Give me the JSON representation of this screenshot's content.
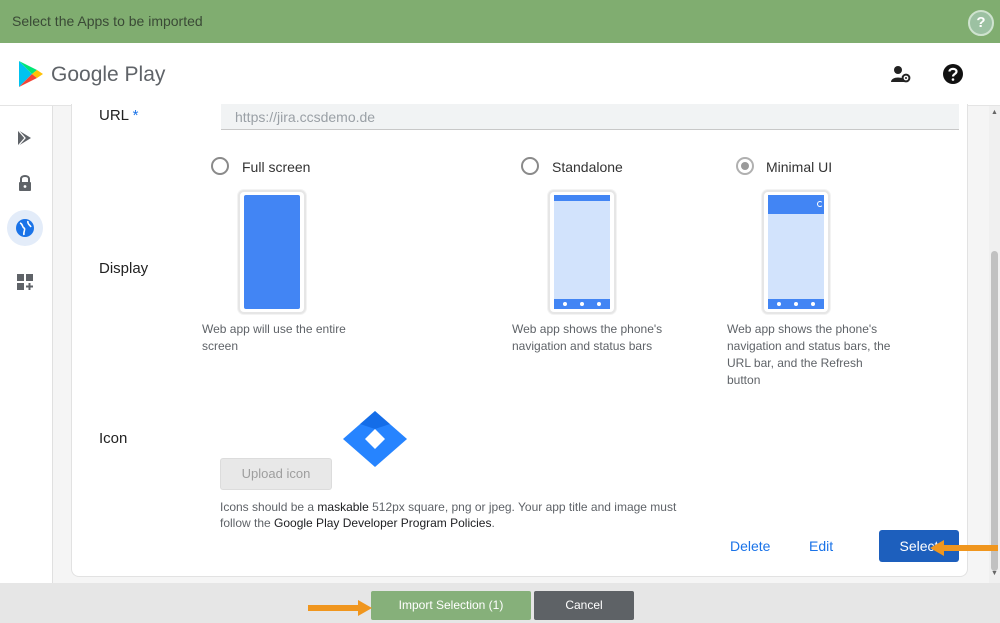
{
  "dialog": {
    "title": "Select the Apps to be imported",
    "help_label": "?"
  },
  "header": {
    "brand": "Google Play"
  },
  "form": {
    "url_label": "URL",
    "required_mark": "*",
    "url_placeholder": "https://jira.ccsdemo.de",
    "display_label": "Display",
    "display_options": [
      {
        "label": "Full screen",
        "desc": "Web app will use the entire screen",
        "selected": false
      },
      {
        "label": "Standalone",
        "desc": "Web app shows the phone's navigation and status bars",
        "selected": false
      },
      {
        "label": "Minimal UI",
        "desc": "Web app shows the phone's navigation and status bars, the URL bar, and the Refresh button",
        "selected": true
      }
    ],
    "icon_label": "Icon",
    "upload_label": "Upload icon",
    "note_a": "Icons should be a ",
    "note_maskable": "maskable",
    "note_b": " 512px square, png or jpeg. Your app title and image must follow the ",
    "note_policies": "Google Play Developer Program Policies",
    "note_c": "."
  },
  "actions": {
    "delete": "Delete",
    "edit": "Edit",
    "select": "Select"
  },
  "footer": {
    "import": "Import Selection (1)",
    "cancel": "Cancel"
  },
  "colors": {
    "accent": "#1a73e8",
    "select_button": "#1d5fbd",
    "titlebar": "#80ad70",
    "arrow": "#f0961e"
  }
}
